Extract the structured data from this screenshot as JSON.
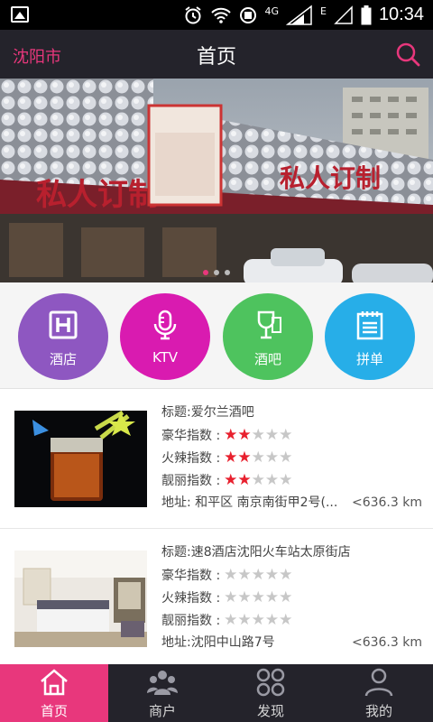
{
  "status_bar": {
    "network": "4G",
    "signal2": "E",
    "time": "10:34"
  },
  "header": {
    "city": "沈阳市",
    "title": "首页"
  },
  "banner": {
    "sign_text_1": "私人订制",
    "sign_text_2": "私人订制",
    "active_dot": 1,
    "dot_count": 3
  },
  "categories": [
    {
      "label": "酒店",
      "icon": "hotel-icon",
      "color": "#8e57c1"
    },
    {
      "label": "KTV",
      "icon": "microphone-icon",
      "color": "#d91bb0"
    },
    {
      "label": "酒吧",
      "icon": "wine-glass-icon",
      "color": "#4ec35e"
    },
    {
      "label": "拼单",
      "icon": "notepad-icon",
      "color": "#27aee8"
    }
  ],
  "listings": [
    {
      "title": "标题:爱尔兰酒吧",
      "luxury_label": "豪华指数 :",
      "luxury": 2,
      "hot_label": "火辣指数 :",
      "hot": 2,
      "pretty_label": "靓丽指数 :",
      "pretty": 2,
      "address": "地址: 和平区 南京南街甲2号(...",
      "distance": "<636.3 km"
    },
    {
      "title": "标题:速8酒店沈阳火车站太原街店",
      "luxury_label": "豪华指数 :",
      "luxury": 0,
      "hot_label": "火辣指数 :",
      "hot": 0,
      "pretty_label": "靓丽指数 :",
      "pretty": 0,
      "address": "地址:沈阳中山路7号",
      "distance": "<636.3 km"
    }
  ],
  "star_max": 5,
  "tabs": [
    {
      "label": "首页",
      "icon": "home-icon",
      "active": true
    },
    {
      "label": "商户",
      "icon": "merchants-icon",
      "active": false
    },
    {
      "label": "发现",
      "icon": "discover-icon",
      "active": false
    },
    {
      "label": "我的",
      "icon": "profile-icon",
      "active": false
    }
  ],
  "colors": {
    "accent": "#e8377c",
    "header_bg": "#24232b",
    "star_on": "#e8202e",
    "star_off": "#c7c7c7"
  }
}
